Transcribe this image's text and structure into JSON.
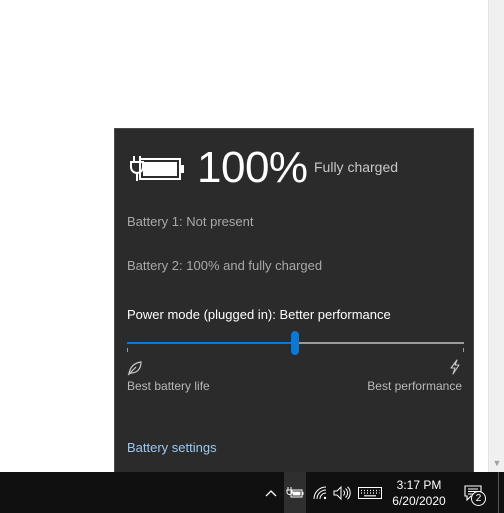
{
  "flyout": {
    "percent": "100%",
    "charge_status": "Fully charged",
    "battery1": "Battery 1: Not present",
    "battery2": "Battery 2: 100% and fully charged",
    "power_mode_label": "Power mode (plugged in): Better performance",
    "slider": {
      "value_fraction": 0.5,
      "left_label": "Best battery life",
      "right_label": "Best performance"
    },
    "settings_link": "Battery settings"
  },
  "taskbar": {
    "icons": {
      "chevron": "chevron-up-icon",
      "battery": "battery-plugged-icon",
      "wifi": "wifi-icon",
      "volume": "volume-icon",
      "keyboard": "touch-keyboard-icon",
      "notifications": "action-center-icon"
    },
    "time": "3:17 PM",
    "date": "6/20/2020",
    "notification_count": "2"
  },
  "colors": {
    "flyout_bg": "#2b2b2b",
    "accent": "#0a78d7",
    "link": "#99c9f4",
    "taskbar_bg": "#101010"
  }
}
